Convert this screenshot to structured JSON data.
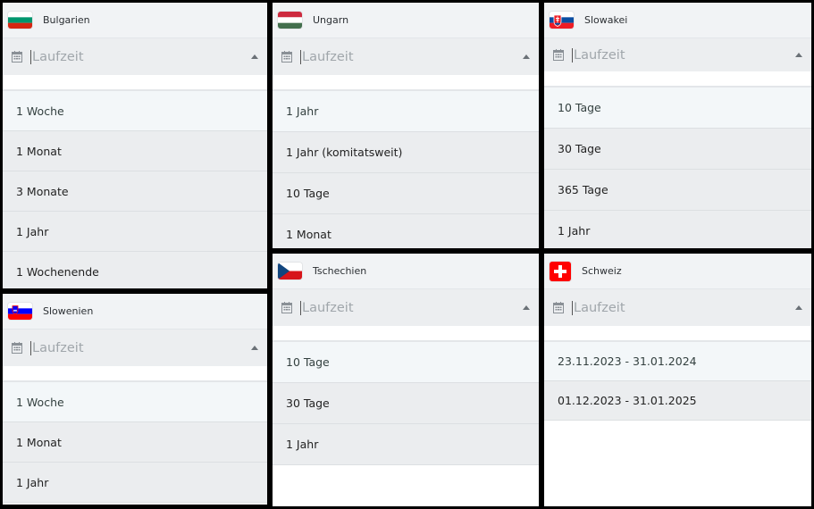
{
  "field_placeholder": "Laufzeit",
  "panels": [
    {
      "country": "Bulgarien",
      "flag": "bulgaria-flag",
      "options": [
        "1 Woche",
        "1 Monat",
        "3 Monate",
        "1 Jahr",
        "1 Wochenende"
      ]
    },
    {
      "country": "Ungarn",
      "flag": "hungary-flag",
      "options": [
        "1 Jahr",
        "1 Jahr (komitatsweit)",
        "10 Tage",
        "1 Monat"
      ]
    },
    {
      "country": "Slowakei",
      "flag": "slovakia-flag",
      "options": [
        "10 Tage",
        "30 Tage",
        "365 Tage",
        "1 Jahr"
      ]
    },
    {
      "country": "Slowenien",
      "flag": "slovenia-flag",
      "options": [
        "1 Woche",
        "1 Monat",
        "1 Jahr"
      ]
    },
    {
      "country": "Tschechien",
      "flag": "czech-flag",
      "options": [
        "10 Tage",
        "30 Tage",
        "1 Jahr"
      ]
    },
    {
      "country": "Schweiz",
      "flag": "switzerland-flag",
      "options": [
        "23.11.2023 - 31.01.2024",
        "01.12.2023 - 31.01.2025"
      ]
    }
  ],
  "colors": {
    "header_bg": "#f1f3f5",
    "field_bg": "#eceef0",
    "option_bg": "#ebedef",
    "option_highlight_bg": "#f3f7f9"
  }
}
